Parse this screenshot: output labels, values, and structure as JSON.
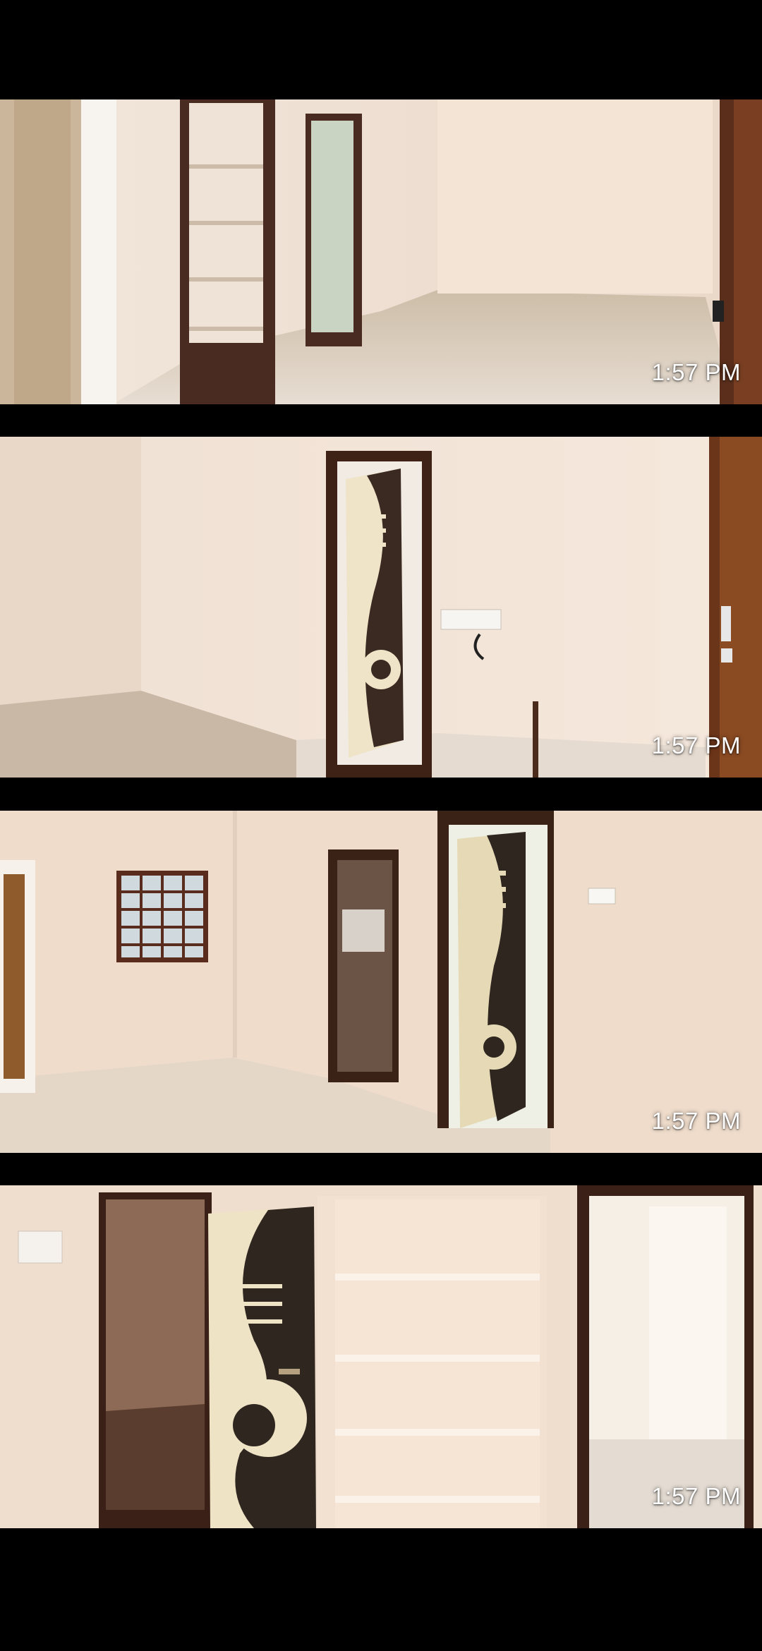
{
  "gallery": {
    "photos": [
      {
        "timestamp": "1:57 PM"
      },
      {
        "timestamp": "1:57 PM"
      },
      {
        "timestamp": "1:57 PM"
      },
      {
        "timestamp": "1:57 PM"
      }
    ]
  }
}
